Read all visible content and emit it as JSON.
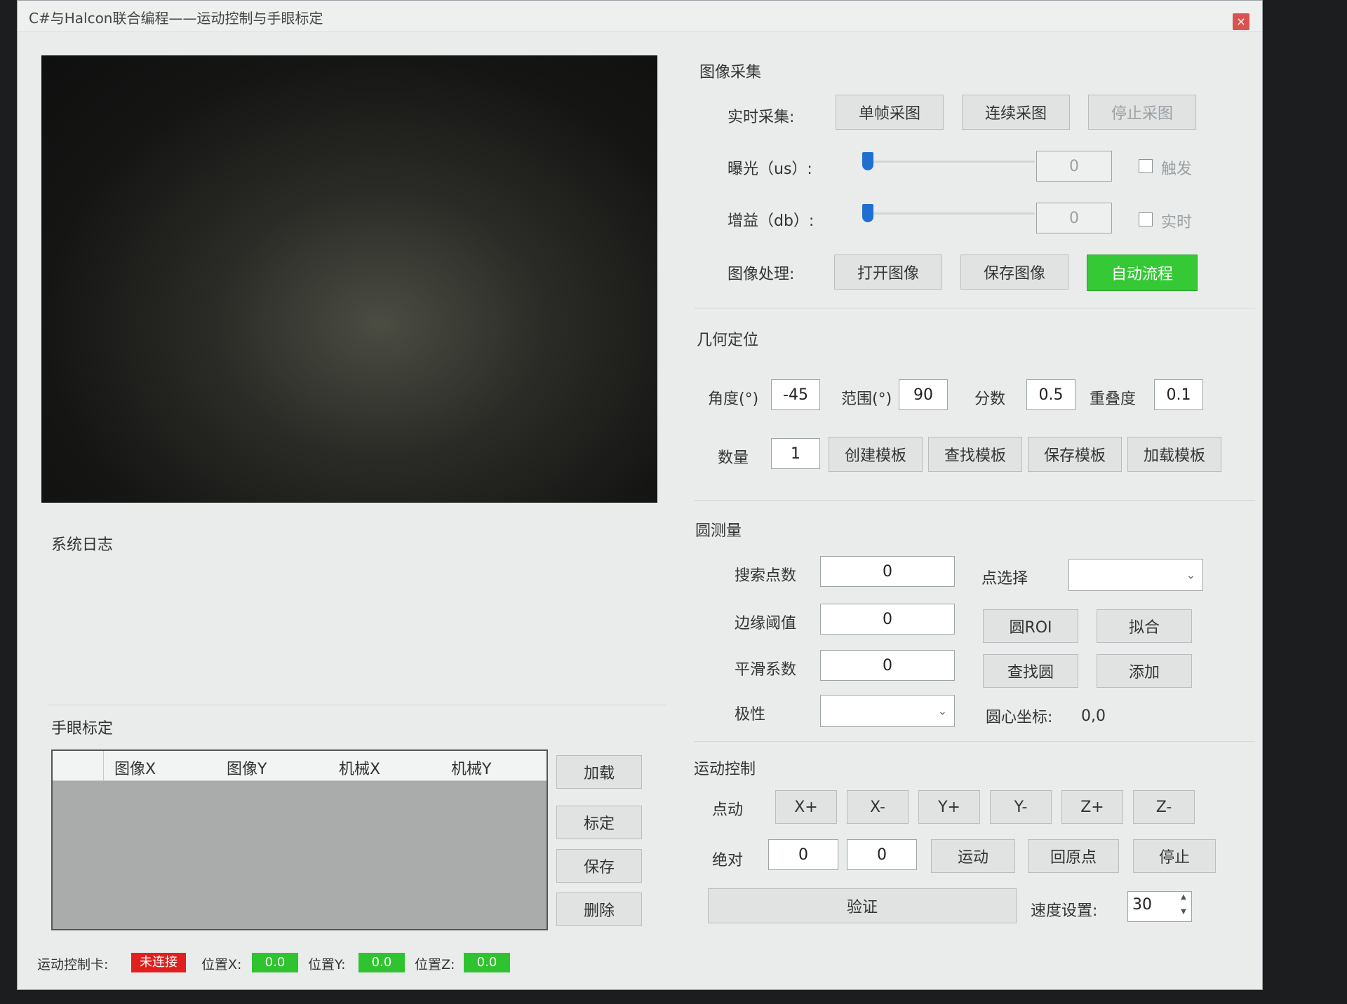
{
  "window": {
    "title": "C#与Halcon联合编程——运动控制与手眼标定",
    "close": "×"
  },
  "acquire": {
    "title": "图像采集",
    "realtime_label": "实时采集:",
    "single_btn": "单帧采图",
    "continuous_btn": "连续采图",
    "stop_btn": "停止采图",
    "exposure_label": "曝光（us）:",
    "exposure_value": "0",
    "trigger_label": "触发",
    "gain_label": "增益（db）:",
    "gain_value": "0",
    "realtime_chk_label": "实时",
    "proc_label": "图像处理:",
    "open_btn": "打开图像",
    "save_btn": "保存图像",
    "auto_btn": "自动流程"
  },
  "geometry": {
    "title": "几何定位",
    "angle_label": "角度(°)",
    "angle_value": "-45",
    "range_label": "范围(°)",
    "range_value": "90",
    "score_label": "分数",
    "score_value": "0.5",
    "overlap_label": "重叠度",
    "overlap_value": "0.1",
    "count_label": "数量",
    "count_value": "1",
    "create_btn": "创建模板",
    "find_btn": "查找模板",
    "save_btn": "保存模板",
    "load_btn": "加载模板"
  },
  "circle": {
    "title": "圆测量",
    "search_label": "搜索点数",
    "search_value": "0",
    "edge_label": "边缘阈值",
    "edge_value": "0",
    "smooth_label": "平滑系数",
    "smooth_value": "0",
    "polarity_label": "极性",
    "point_select_label": "点选择",
    "roi_btn": "圆ROI",
    "fit_btn": "拟合",
    "find_btn": "查找圆",
    "add_btn": "添加",
    "center_label": "圆心坐标:",
    "center_value": "0,0"
  },
  "motion": {
    "title": "运动控制",
    "jog_label": "点动",
    "jog_buttons": [
      "X+",
      "X-",
      "Y+",
      "Y-",
      "Z+",
      "Z-"
    ],
    "abs_label": "绝对",
    "abs_x": "0",
    "abs_y": "0",
    "move_btn": "运动",
    "home_btn": "回原点",
    "stop_btn": "停止",
    "verify_btn": "验证",
    "speed_label": "速度设置:",
    "speed_value": "30"
  },
  "log": {
    "title": "系统日志"
  },
  "handeye": {
    "title": "手眼标定",
    "columns": [
      "图像X",
      "图像Y",
      "机械X",
      "机械Y"
    ],
    "load_btn": "加载",
    "calib_btn": "标定",
    "save_btn": "保存",
    "delete_btn": "删除"
  },
  "status": {
    "card_label": "运动控制卡:",
    "card_value": "未连接",
    "pos_x_label": "位置X:",
    "pos_x": "0.0",
    "pos_y_label": "位置Y:",
    "pos_y": "0.0",
    "pos_z_label": "位置Z:",
    "pos_z": "0.0",
    "colors": {
      "disconnected": "#e0201e",
      "ok": "#2fc42f",
      "auto": "#35c935"
    }
  }
}
